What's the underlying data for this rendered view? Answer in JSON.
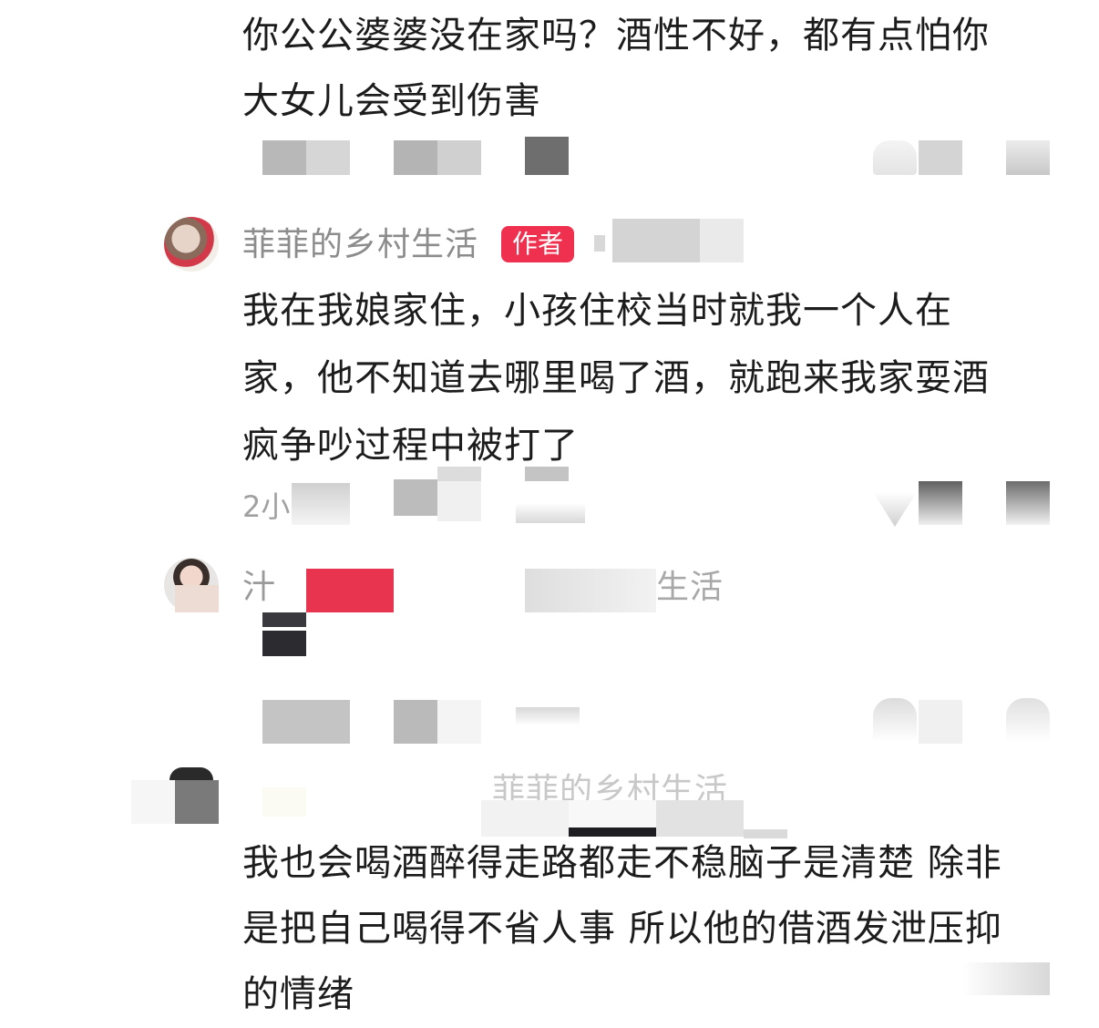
{
  "comment1": {
    "text_line1": "你公公婆婆没在家吗？酒性不好，都有点怕你",
    "text_line2": "大女儿会受到伤害"
  },
  "comment2": {
    "username": "菲菲的乡村生活",
    "badge": "作者",
    "text_line1": "我在我娘家住，小孩住校当时就我一个人在",
    "text_line2": "家，他不知道去哪里喝了酒，就跑来我家耍酒",
    "text_line3": "疯争吵过程中被打了",
    "time_partial": "2小"
  },
  "comment3": {
    "username_partial": "汁",
    "reply_to_partial": "生活"
  },
  "comment4": {
    "reply_to_partial": "菲菲的乡村生活",
    "text_line1": "我也会喝酒醉得走路都走不稳脑子是清楚 除非",
    "text_line2": "是把自己喝得不省人事 所以他的借酒发泄压抑",
    "text_line3": "的情绪"
  }
}
